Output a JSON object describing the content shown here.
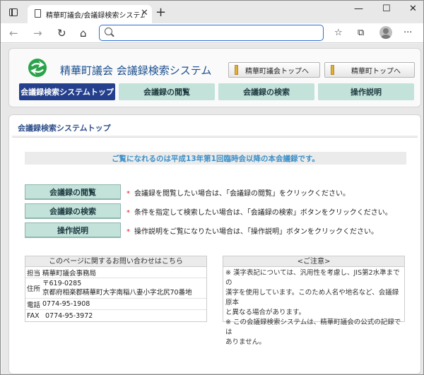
{
  "browser": {
    "tab_title": "精華町議会/会議録検索システム",
    "tab_close": "✕",
    "new_tab": "+",
    "minimize": "—",
    "maximize": "☐",
    "close": "✕",
    "back": "←",
    "forward": "→",
    "reload": "↻",
    "home": "⌂",
    "address_value": "",
    "favorites": "☆",
    "collections": "⧉",
    "more": "···"
  },
  "header": {
    "site_title": "精華町議会 会議録検索システム",
    "top_links": [
      {
        "label": "精華町議会トップへ"
      },
      {
        "label": "精華町トップへ"
      }
    ]
  },
  "nav": {
    "items": [
      {
        "label": "会議録検索システムトップ",
        "active": true
      },
      {
        "label": "会議録の閲覧",
        "active": false
      },
      {
        "label": "会議録の検索",
        "active": false
      },
      {
        "label": "操作説明",
        "active": false
      }
    ]
  },
  "main": {
    "section_title": "会議録検索システムトップ",
    "notice": "ご覧になれるのは平成13年第1回臨時会以降の本会議録です。",
    "actions": [
      {
        "label": "会議録の閲覧",
        "star": "*",
        "description": "会議録を閲覧したい場合は、「会議録の閲覧」をクリックください。"
      },
      {
        "label": "会議録の検索",
        "star": "*",
        "description": "条件を指定して検索したい場合は、「会議録の検索」ボタンをクリックください。"
      },
      {
        "label": "操作説明",
        "star": "*",
        "description": "操作説明をご覧になりたい場合は、「操作説明」ボタンをクリックください。"
      }
    ]
  },
  "contact": {
    "heading": "このページに関するお問い合わせはこちら",
    "rows": [
      {
        "label": "担当",
        "value": "精華町議会事務局"
      },
      {
        "label": "住所",
        "value_line1": "〒619-0285",
        "value_line2": "京都府相楽郡精華町大字南稲八妻小字北尻70番地"
      },
      {
        "label": "電話",
        "value": "0774-95-1908"
      },
      {
        "label": "FAX",
        "value": "0774-95-3972"
      }
    ]
  },
  "caution": {
    "heading": "<ご注意>",
    "lines": [
      "※ 漢字表記については、汎用性を考慮し、JIS第2水準までの",
      "漢字を使用しています。このため人名や地名など、会議録原本",
      "と異なる場合があります。",
      "※ この会議録検索システムは、精華町議会の公式の記録では",
      "ありません。"
    ]
  },
  "colors": {
    "nav_active": "#243f8c",
    "nav_normal": "#c2e2da",
    "title_blue": "#1b4f8f",
    "notice_text": "#3b8fc7",
    "logo_green": "#2aa34a"
  }
}
